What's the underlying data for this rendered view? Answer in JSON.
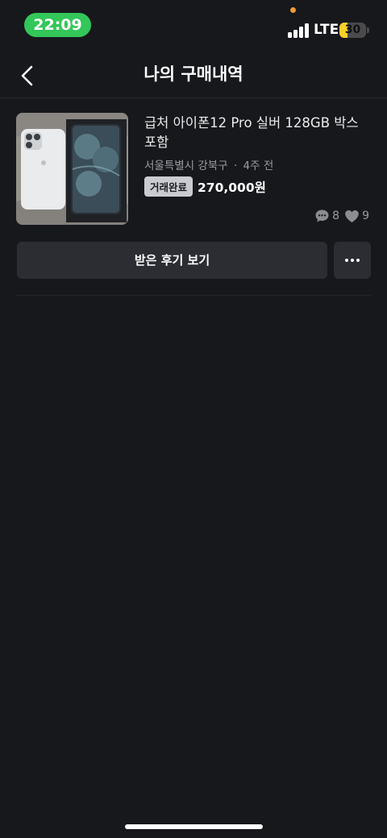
{
  "status_bar": {
    "time": "22:09",
    "network": "LTE",
    "battery": "30",
    "battery_level": 0.3,
    "time_pill_color": "#33c759",
    "battery_color": "#f7d02c"
  },
  "header": {
    "title": "나의 구매내역",
    "back_icon": "chevron-left-icon"
  },
  "item": {
    "title": "급처 아이폰12 Pro 실버 128GB 박스 포함",
    "location": "서울특별시 강북구",
    "time_ago": "4주 전",
    "separator": "·",
    "status": "거래완료",
    "price": "270,000원",
    "chat_count": "8",
    "like_count": "9",
    "chat_icon": "chat-bubble-icon",
    "like_icon": "heart-icon"
  },
  "actions": {
    "review_label": "받은 후기 보기",
    "more_icon": "ellipsis-icon"
  }
}
